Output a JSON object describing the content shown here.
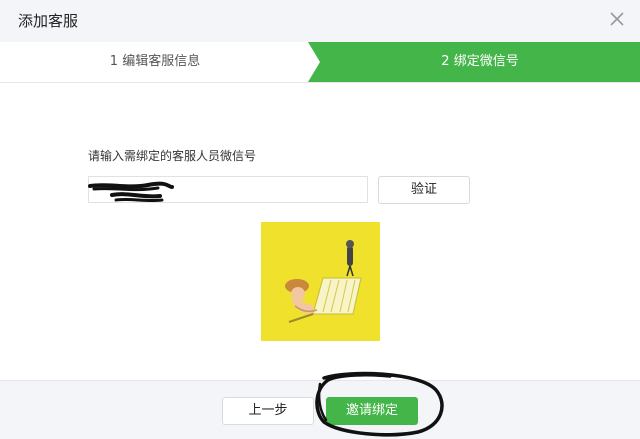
{
  "dialog": {
    "title": "添加客服",
    "close_icon": "close-icon"
  },
  "steps": [
    {
      "label": "1 编辑客服信息",
      "active": false
    },
    {
      "label": "2 绑定微信号",
      "active": true
    }
  ],
  "form": {
    "prompt": "请输入需绑定的客服人员微信号",
    "wechat_input_value": "",
    "verify_label": "验证"
  },
  "footer": {
    "prev_label": "上一步",
    "invite_label": "邀请绑定"
  },
  "colors": {
    "accent": "#44b549",
    "qr_background": "#f0e22c",
    "header_bg": "#f4f5f9"
  }
}
